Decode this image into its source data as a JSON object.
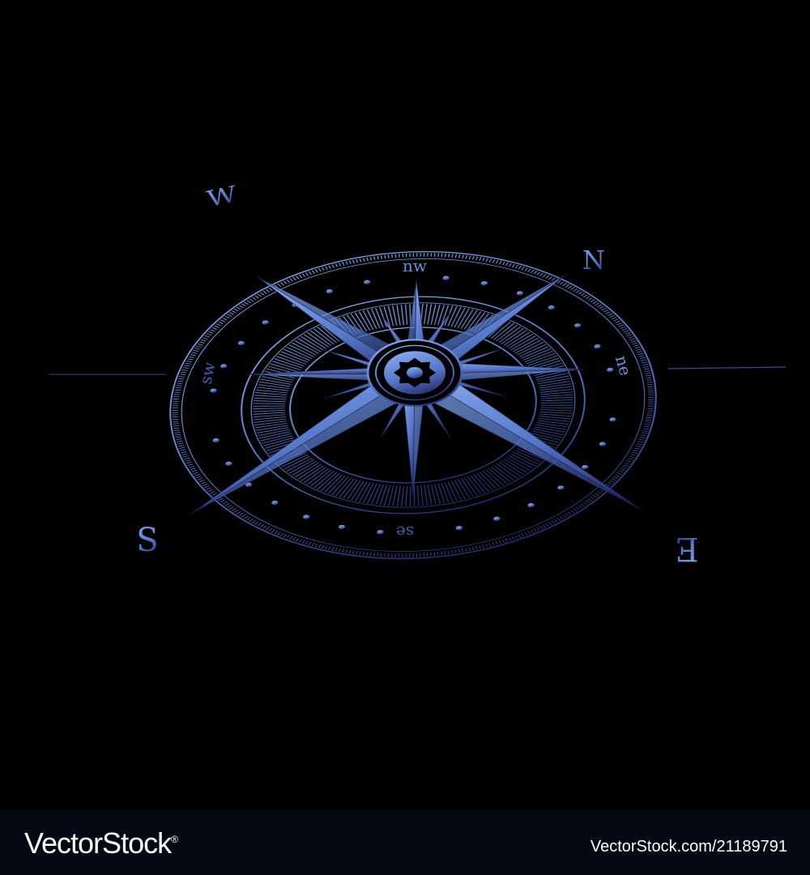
{
  "compass": {
    "cardinals": {
      "n": "N",
      "e": "E",
      "s": "S",
      "w": "W"
    },
    "intercardinals": {
      "nw": "nw",
      "ne": "ne",
      "se": "se",
      "sw": "sw"
    }
  },
  "colors": {
    "background": "#000000",
    "rose_light": "#7ea2e8",
    "rose_mid": "#4e6fc4",
    "rose_dark": "#2a2f6e",
    "footer_bg": "#050913",
    "footer_text": "#ffffff"
  },
  "footer": {
    "logo": "VectorStock",
    "logo_mark": "®",
    "image_id": "VectorStock.com/21189791"
  }
}
